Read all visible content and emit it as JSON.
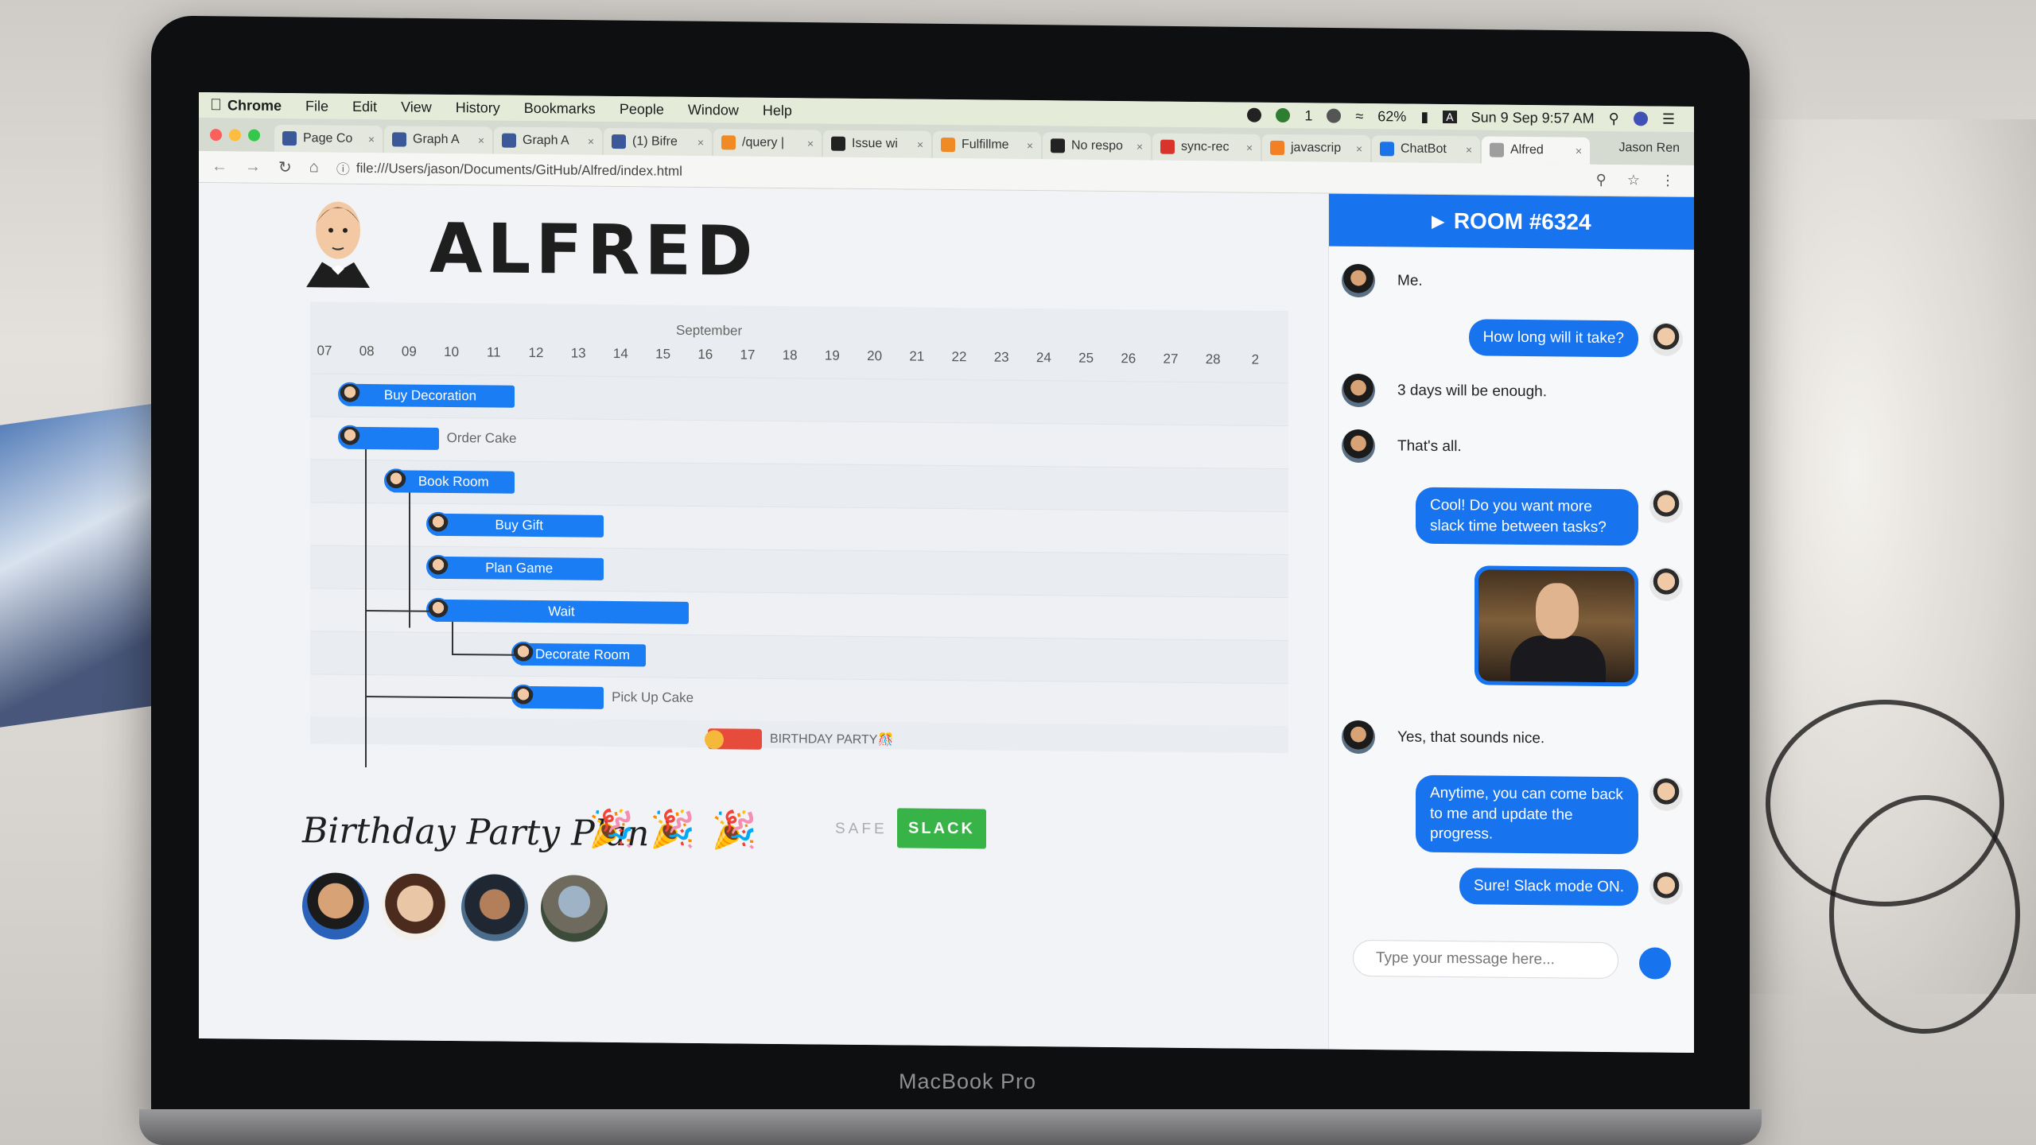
{
  "menubar": {
    "app": "Chrome",
    "items": [
      "File",
      "Edit",
      "View",
      "History",
      "Bookmarks",
      "People",
      "Window",
      "Help"
    ],
    "wechat_count": "1",
    "battery": "62%",
    "datetime": "Sun 9 Sep  9:57 AM"
  },
  "tabs": [
    {
      "label": "Page Co",
      "favicon": "facebook-icon",
      "color": "#3b5998"
    },
    {
      "label": "Graph A",
      "favicon": "facebook-icon",
      "color": "#3b5998"
    },
    {
      "label": "Graph A",
      "favicon": "facebook-icon",
      "color": "#3b5998"
    },
    {
      "label": "(1) Bifre",
      "favicon": "facebook-icon",
      "color": "#3b5998"
    },
    {
      "label": "/query |",
      "favicon": "dialogflow-icon",
      "color": "#f08a24"
    },
    {
      "label": "Issue wi",
      "favicon": "github-icon",
      "color": "#222222"
    },
    {
      "label": "Fulfillme",
      "favicon": "dialogflow-icon",
      "color": "#f08a24"
    },
    {
      "label": "No respo",
      "favicon": "github-icon",
      "color": "#222222"
    },
    {
      "label": "sync-rec",
      "favicon": "stackshare-icon",
      "color": "#d9342b"
    },
    {
      "label": "javascrip",
      "favicon": "stackoverflow-icon",
      "color": "#f48024"
    },
    {
      "label": "ChatBot",
      "favicon": "chatbot-icon",
      "color": "#1a73e8"
    },
    {
      "label": "Alfred",
      "favicon": "file-icon",
      "color": "#9e9e9e"
    }
  ],
  "profile": "Jason Ren",
  "url": "file:///Users/jason/Documents/GitHub/Alfred/index.html",
  "app": {
    "title": "ALFRED",
    "gantt": {
      "month": "September",
      "days": [
        "07",
        "08",
        "09",
        "10",
        "11",
        "12",
        "13",
        "14",
        "15",
        "16",
        "17",
        "18",
        "19",
        "20",
        "21",
        "22",
        "23",
        "24",
        "25",
        "26",
        "27",
        "28",
        "2"
      ],
      "tasks": [
        {
          "label": "Buy Decoration",
          "start_day": 7.5,
          "end_day": 11.5,
          "inside": true
        },
        {
          "label": "Order Cake",
          "start_day": 7.5,
          "end_day": 9.7,
          "inside": false
        },
        {
          "label": "Book Room",
          "start_day": 8.6,
          "end_day": 11.5,
          "inside": true
        },
        {
          "label": "Buy Gift",
          "start_day": 9.6,
          "end_day": 13.6,
          "inside": true
        },
        {
          "label": "Plan Game",
          "start_day": 9.6,
          "end_day": 13.6,
          "inside": true
        },
        {
          "label": "Wait",
          "start_day": 9.6,
          "end_day": 15.6,
          "inside": true
        },
        {
          "label": "Decorate Room",
          "start_day": 11.6,
          "end_day": 14.6,
          "inside": true
        },
        {
          "label": "Pick Up Cake",
          "start_day": 11.6,
          "end_day": 13.6,
          "inside": false
        }
      ],
      "milestone": "BIRTHDAY PARTY🎊"
    },
    "plan_title": "Birthday Party Plan",
    "party_icons": [
      "🎉",
      "🎉",
      "🎉"
    ],
    "mode_safe": "SAFE",
    "mode_slack": "SLACK"
  },
  "chat": {
    "room": "ROOM #6324",
    "messages": [
      {
        "from": "user",
        "text": "Me."
      },
      {
        "from": "bot",
        "text": "How long will it take?"
      },
      {
        "from": "user",
        "text": "3 days will be enough."
      },
      {
        "from": "user",
        "text": "That's all."
      },
      {
        "from": "bot",
        "text": "Cool! Do you want more slack time between tasks?"
      },
      {
        "from": "bot",
        "image": "alfred-butler-image"
      },
      {
        "from": "user",
        "text": "Yes, that sounds nice."
      },
      {
        "from": "bot",
        "text": "Anytime, you can come back to me and update the progress."
      },
      {
        "from": "bot",
        "text": "Sure! Slack mode ON."
      }
    ],
    "input_placeholder": "Type your message here..."
  }
}
